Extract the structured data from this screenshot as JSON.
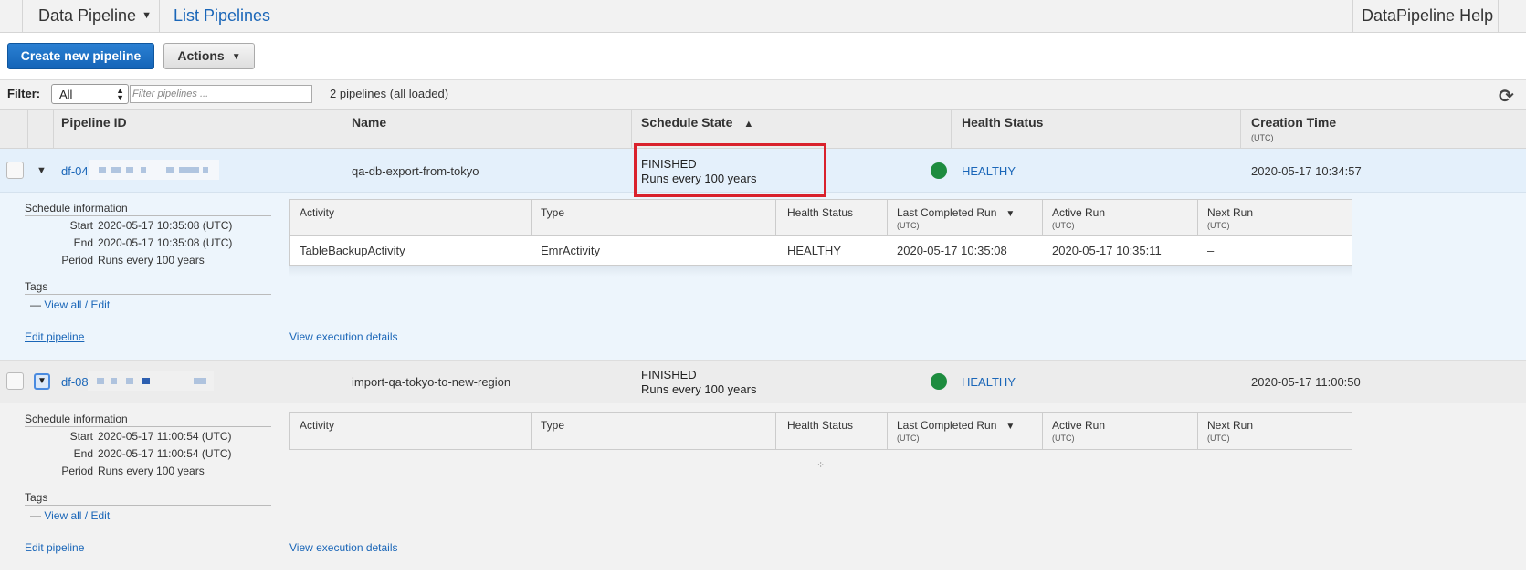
{
  "topbar": {
    "service": "Data Pipeline",
    "breadcrumb": "List Pipelines",
    "help": "DataPipeline Help"
  },
  "toolbar": {
    "create_label": "Create new pipeline",
    "actions_label": "Actions"
  },
  "filter": {
    "label": "Filter:",
    "selected": "All",
    "placeholder": "Filter pipelines ...",
    "count_text": "2 pipelines (all loaded)"
  },
  "columns": {
    "pipeline_id": "Pipeline ID",
    "name": "Name",
    "schedule_state": "Schedule State",
    "health_status": "Health Status",
    "creation_time": "Creation Time",
    "creation_time_sub": "(UTC)"
  },
  "pipelines": [
    {
      "id_prefix": "df-04",
      "name": "qa-db-export-from-tokyo",
      "state": "FINISHED",
      "schedule": "Runs every 100 years",
      "health": "HEALTHY",
      "created": "2020-05-17 10:34:57",
      "schedule_info_title": "Schedule information",
      "start_label": "Start",
      "start": "2020-05-17 10:35:08 (UTC)",
      "end_label": "End",
      "end": "2020-05-17 10:35:08 (UTC)",
      "period_label": "Period",
      "period": "Runs every 100 years",
      "tags_title": "Tags",
      "tags_dash": "—",
      "view_all": "View all / Edit",
      "edit_pipeline": "Edit pipeline",
      "view_execution": "View execution details",
      "activities": [
        {
          "activity": "TableBackupActivity",
          "type": "EmrActivity",
          "health": "HEALTHY",
          "last_completed": "2020-05-17 10:35:08",
          "active_run": "2020-05-17 10:35:11",
          "next_run": "–"
        }
      ]
    },
    {
      "id_prefix": "df-08",
      "name": "import-qa-tokyo-to-new-region",
      "state": "FINISHED",
      "schedule": "Runs every 100 years",
      "health": "HEALTHY",
      "created": "2020-05-17 11:00:50",
      "schedule_info_title": "Schedule information",
      "start_label": "Start",
      "start": "2020-05-17 11:00:54 (UTC)",
      "end_label": "End",
      "end": "2020-05-17 11:00:54 (UTC)",
      "period_label": "Period",
      "period": "Runs every 100 years",
      "tags_title": "Tags",
      "tags_dash": "—",
      "view_all": "View all / Edit",
      "edit_pipeline": "Edit pipeline",
      "view_execution": "View execution details",
      "activities": []
    }
  ],
  "activity_columns": {
    "activity": "Activity",
    "type": "Type",
    "health": "Health Status",
    "last_completed": "Last Completed Run",
    "active_run": "Active Run",
    "next_run": "Next Run",
    "utc": "(UTC)"
  },
  "icons": {
    "health_dot_color": "#1d8c3f",
    "highlight_color": "#d9212c"
  }
}
